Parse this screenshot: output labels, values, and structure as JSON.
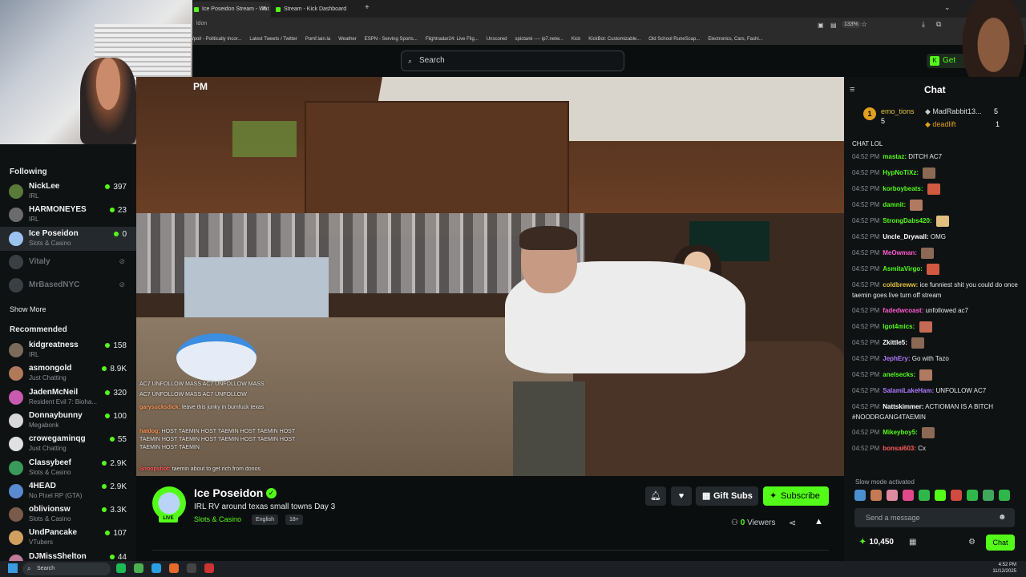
{
  "browser": {
    "tabs": [
      {
        "label": "Ice Poseidon Stream - Wat"
      },
      {
        "label": "Stream - Kick Dashboard"
      }
    ],
    "zoom": "133%",
    "bookmarks": [
      "/pol/ - Politically Incor...",
      "Latest Tweets / Twitter",
      "Pomf.lain.la",
      "Weather",
      "ESPN - Serving Sports...",
      "Flightradar24: Live Flig...",
      "Unscored",
      "spictank ---- ip7.netw...",
      "Kick",
      "KickBot: Customizable...",
      "Old School RuneScap...",
      "Electronics, Cars, Fashi..."
    ]
  },
  "header": {
    "search_placeholder": "Search",
    "get_label": "Get"
  },
  "sidebar": {
    "following_title": "Following",
    "following": [
      {
        "name": "NickLee",
        "category": "IRL",
        "viewers": "397",
        "color": "#5b7a3a"
      },
      {
        "name": "HARMONEYES",
        "category": "IRL",
        "viewers": "23",
        "color": "#6b6b6b"
      },
      {
        "name": "Ice Poseidon",
        "category": "Slots & Casino",
        "viewers": "0",
        "color": "#9cc3f0"
      },
      {
        "name": "Vitaly",
        "category": "",
        "viewers": "",
        "color": "#3a3f44"
      },
      {
        "name": "MrBasedNYC",
        "category": "",
        "viewers": "",
        "color": "#3a3f44"
      }
    ],
    "show_more": "Show More",
    "recommended_title": "Recommended",
    "recommended": [
      {
        "name": "kidgreatness",
        "category": "IRL",
        "viewers": "158",
        "color": "#7a6b5b"
      },
      {
        "name": "asmongold",
        "category": "Just Chatting",
        "viewers": "8.9K",
        "color": "#b07a5a"
      },
      {
        "name": "JadenMcNeil",
        "category": "Resident Evil 7: Bioha...",
        "viewers": "320",
        "color": "#c85ab0"
      },
      {
        "name": "Donnaybunny",
        "category": "Megabonk",
        "viewers": "100",
        "color": "#d8d8d8"
      },
      {
        "name": "crowegaminqg",
        "category": "Just Chatting",
        "viewers": "55",
        "color": "#e0e0e0"
      },
      {
        "name": "Classybeef",
        "category": "Slots & Casino",
        "viewers": "2.9K",
        "color": "#3a9a5a"
      },
      {
        "name": "4HEAD",
        "category": "No Pixel RP (GTA)",
        "viewers": "2.9K",
        "color": "#5a8ad0"
      },
      {
        "name": "oblivionsw",
        "category": "Slots & Casino",
        "viewers": "3.3K",
        "color": "#7a5a4a"
      },
      {
        "name": "UndPancake",
        "category": "VTubers",
        "viewers": "107",
        "color": "#d0a060"
      },
      {
        "name": "DJMissShelton",
        "category": "",
        "viewers": "44",
        "color": "#c07a9a"
      }
    ]
  },
  "video": {
    "time_fragment": "PM",
    "overlay_chat": [
      {
        "user": "",
        "text": "AC7 UNFOLLOW   MASS AC7 UNFOLLOW   MASS"
      },
      {
        "user": "",
        "text": "AC7 UNFOLLOW   MASS AC7 UNFOLLOW"
      },
      {
        "user": "garysucksdick:",
        "text": "leave this junky in bumfuck texas"
      },
      {
        "user": "hatdog:",
        "text": "HOST TAEMIN HOST TAEMIN HOST TAEMIN HOST TAEMIN HOST TAEMIN HOST TAEMIN HOST TAEMIN HOST TAEMIN HOST TAEMIN"
      },
      {
        "user": "Snoopshot:",
        "text": "taemin about to get rich from donos"
      }
    ]
  },
  "stream_info": {
    "streamer": "Ice Poseidon",
    "live_label": "LIVE",
    "title": "IRL RV around texas small towns Day 3",
    "category": "Slots & Casino",
    "tags": [
      "English",
      "18+"
    ],
    "gift_label": "Gift Subs",
    "subscribe_label": "Subscribe",
    "viewer_count": "0",
    "viewers_label": "Viewers"
  },
  "chat": {
    "title": "Chat",
    "top_gifters": [
      {
        "rank": "1",
        "name": "emo_tions",
        "count": "5"
      },
      {
        "name": "MadRabbit13...",
        "count": "5"
      },
      {
        "name": "deadlift",
        "count": "1"
      }
    ],
    "partial_first": "CHAT LOL",
    "messages": [
      {
        "time": "04:52 PM",
        "user": "mastaz:",
        "text": "DITCH AC7",
        "color": "#53fc18",
        "emote": false
      },
      {
        "time": "04:52 PM",
        "user": "HypNoTiXz:",
        "text": "",
        "color": "#53fc18",
        "emote": true
      },
      {
        "time": "04:52 PM",
        "user": "korboybeats:",
        "text": "",
        "color": "#53fc18",
        "emote": true
      },
      {
        "time": "04:52 PM",
        "user": "damnit:",
        "text": "",
        "color": "#53fc18",
        "emote": true
      },
      {
        "time": "04:52 PM",
        "user": "StrongDabs420:",
        "text": "",
        "color": "#53fc18",
        "emote": true
      },
      {
        "time": "04:52 PM",
        "user": "Uncle_Drywall:",
        "text": "OMG",
        "color": "#ffffff",
        "emote": false
      },
      {
        "time": "04:52 PM",
        "user": "MeOwman:",
        "text": "",
        "color": "#ff5ad0",
        "emote": true
      },
      {
        "time": "04:52 PM",
        "user": "AsmitaVirgo:",
        "text": "",
        "color": "#53fc18",
        "emote": true
      },
      {
        "time": "04:52 PM",
        "user": "coldbreww:",
        "text": "ice funniest shit you could do once taemin goes live turn off stream",
        "color": "#e0c040",
        "emote": false,
        "wrap": true
      },
      {
        "time": "04:52 PM",
        "user": "fadedwcoast:",
        "text": "unfollowed ac7",
        "color": "#ff5ad0",
        "emote": false
      },
      {
        "time": "04:52 PM",
        "user": "lgot4mics:",
        "text": "",
        "color": "#53fc18",
        "emote": true
      },
      {
        "time": "04:52 PM",
        "user": "Zkittle5:",
        "text": "",
        "color": "#ffffff",
        "emote": true
      },
      {
        "time": "04:52 PM",
        "user": "JephEry:",
        "text": "Go with Tazo",
        "color": "#b07aff",
        "emote": false
      },
      {
        "time": "04:52 PM",
        "user": "anelsecks:",
        "text": "",
        "color": "#53fc18",
        "emote": true
      },
      {
        "time": "04:52 PM",
        "user": "SalamiLakeHam:",
        "text": "UNFOLLOW AC7",
        "color": "#b07aff",
        "emote": false
      },
      {
        "time": "04:52 PM",
        "user": "Nattskimmer:",
        "text": "ACTIOMAN IS A BITCH #NOODRGANG4TAEMIN",
        "color": "#ffffff",
        "emote": false,
        "wrap": true
      },
      {
        "time": "04:52 PM",
        "user": "Mikeyboy5:",
        "text": "",
        "color": "#53fc18",
        "emote": true
      },
      {
        "time": "04:52 PM",
        "user": "bonsai603:",
        "text": "Cx",
        "color": "#ff5a5a",
        "emote": false
      }
    ],
    "slow_mode": "Slow mode activated",
    "input_placeholder": "Send a message",
    "points": "10,450",
    "send_label": "Chat"
  },
  "taskbar": {
    "search_label": "Search",
    "time": "4:52 PM",
    "date": "11/12/2025"
  }
}
